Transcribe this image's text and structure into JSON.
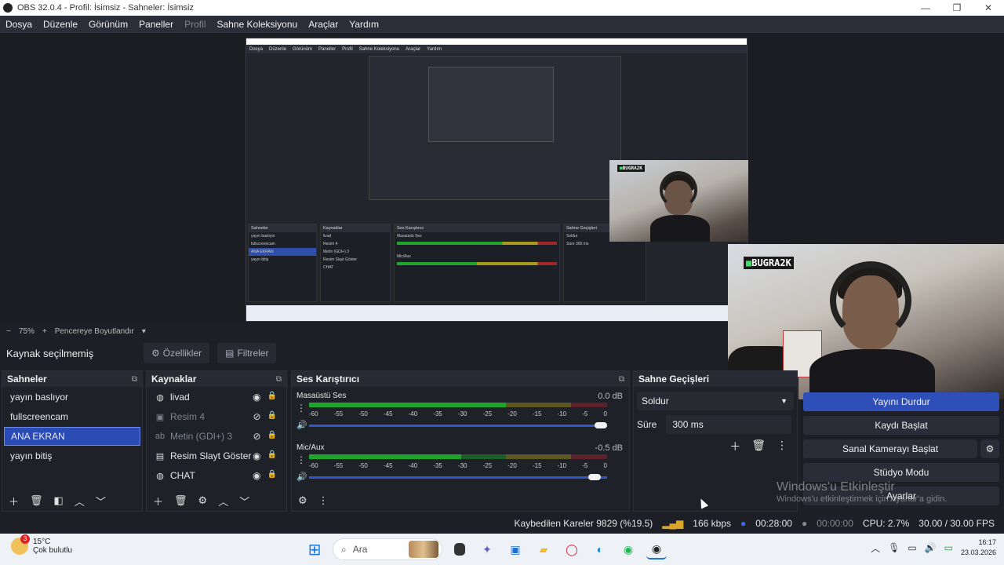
{
  "window": {
    "title": "OBS 32.0.4 - Profil: İsimsiz - Sahneler: İsimsiz",
    "min": "—",
    "max": "❐",
    "close": "✕"
  },
  "menu": [
    "Dosya",
    "Düzenle",
    "Görünüm",
    "Paneller",
    "Profil",
    "Sahne Koleksiyonu",
    "Araçlar",
    "Yardım"
  ],
  "zoom": {
    "minus": "−",
    "value": "75%",
    "plus": "+",
    "mode": "Pencereye Boyutlandır",
    "arrow": "▾"
  },
  "source_bar": {
    "label": "Kaynak seçilmemiş",
    "properties": "Özellikler",
    "filters": "Filtreler"
  },
  "scenes": {
    "title": "Sahneler",
    "items": [
      "yayın baslıyor",
      "fullscreencam",
      "ANA EKRAN",
      "yayın bitiş"
    ],
    "selected": 2
  },
  "sources": {
    "title": "Kaynaklar",
    "items": [
      {
        "name": "livad",
        "icon": "globe-icon",
        "dim": false
      },
      {
        "name": "Resim 4",
        "icon": "image-icon",
        "dim": true
      },
      {
        "name": "Metin (GDI+) 3",
        "icon": "text-icon",
        "dim": true
      },
      {
        "name": "Resim Slayt Göster",
        "icon": "slideshow-icon",
        "dim": false
      },
      {
        "name": "CHAT",
        "icon": "globe-icon",
        "dim": false
      }
    ]
  },
  "mixer": {
    "title": "Ses Karıştırıcı",
    "channels": [
      {
        "name": "Masaüstü Ses",
        "db": "0.0 dB",
        "level": 0.66
      },
      {
        "name": "Mic/Aux",
        "db": "-0.5 dB",
        "level": 0.51
      }
    ],
    "ticks": [
      "-60",
      "-55",
      "-50",
      "-45",
      "-40",
      "-35",
      "-30",
      "-25",
      "-20",
      "-15",
      "-10",
      "-5",
      "0"
    ]
  },
  "transitions": {
    "title": "Sahne Geçişleri",
    "type": "Soldur",
    "duration_label": "Süre",
    "duration": "300 ms"
  },
  "controls": {
    "stop_stream": "Yayını Durdur",
    "start_record": "Kaydı Başlat",
    "virtual_cam": "Sanal Kamerayı Başlat",
    "studio": "Stüdyo Modu",
    "settings": "Ayarlar"
  },
  "status": {
    "dropped": "Kaybedilen Kareler 9829 (%19.5)",
    "bitrate": "166 kbps",
    "stream_time": "00:28:00",
    "rec_time": "00:00:00",
    "cpu": "CPU: 2.7%",
    "fps": "30.00 / 30.00 FPS"
  },
  "watermark": {
    "line1": "Windows'u Etkinleştir",
    "line2": "Windows'u etkinleştirmek için Ayarlar'a gidin."
  },
  "taskbar": {
    "temp": "15°C",
    "weather": "Çok bulutlu",
    "badge": "3",
    "search": "Ara",
    "time": "16:17",
    "date": "23.03.2026"
  },
  "webcam": {
    "logo": "BUGRA2K"
  },
  "colors": {
    "accent": "#2f4fb8",
    "meter_green": "#1fa52b",
    "meter_yellow": "#a89a1c",
    "meter_red": "#a3262a"
  }
}
